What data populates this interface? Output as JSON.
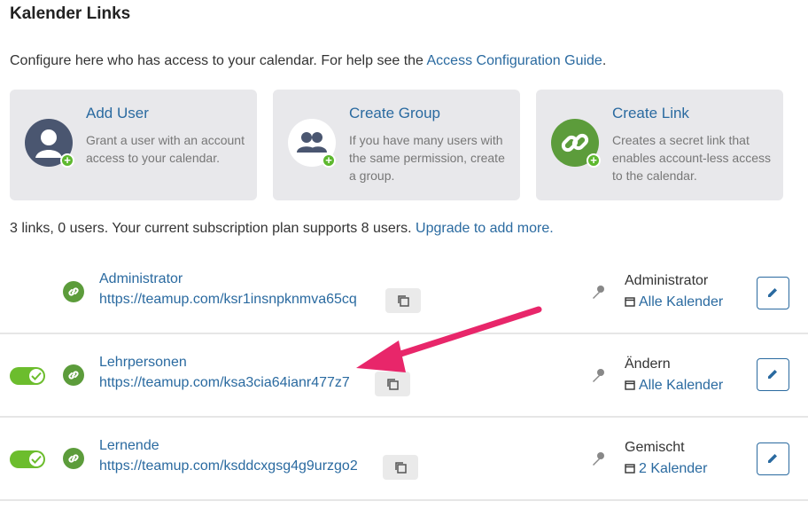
{
  "header": {
    "title": "Kalender Links"
  },
  "intro": {
    "text": "Configure here who has access to your calendar. For help see the ",
    "link": "Access Configuration Guide",
    "end": "."
  },
  "cards": [
    {
      "title": "Add User",
      "desc": "Grant a user with an account access to your calendar.",
      "icon": "user-icon",
      "color": "#4a5670"
    },
    {
      "title": "Create Group",
      "desc": "If you have many users with the same permission, create a group.",
      "icon": "group-icon",
      "color": "#4a5670"
    },
    {
      "title": "Create Link",
      "desc": "Creates a secret link that enables account-less access to the calendar.",
      "icon": "link-icon",
      "color": "#5c9c3b"
    }
  ],
  "summary": {
    "text": "3 links, 0 users. Your current subscription plan supports 8 users. ",
    "link": "Upgrade to add more."
  },
  "links": [
    {
      "name": "Administrator",
      "url": "https://teamup.com/ksr1insnpknmva65cq",
      "permission": "Administrator",
      "calendars": "Alle Kalender",
      "toggle": null
    },
    {
      "name": "Lehrpersonen",
      "url": "https://teamup.com/ksa3cia64ianr477z7",
      "permission": "Ändern",
      "calendars": "Alle Kalender",
      "toggle": "on"
    },
    {
      "name": "Lernende",
      "url": "https://teamup.com/ksddcxgsg4g9urzgo2",
      "permission": "Gemischt",
      "calendars": "2 Kalender",
      "toggle": "on"
    }
  ],
  "colors": {
    "accent": "#2a6aa0",
    "green": "#5c9c3b",
    "toggle": "#6cbd2d",
    "arrow": "#e8266a"
  }
}
